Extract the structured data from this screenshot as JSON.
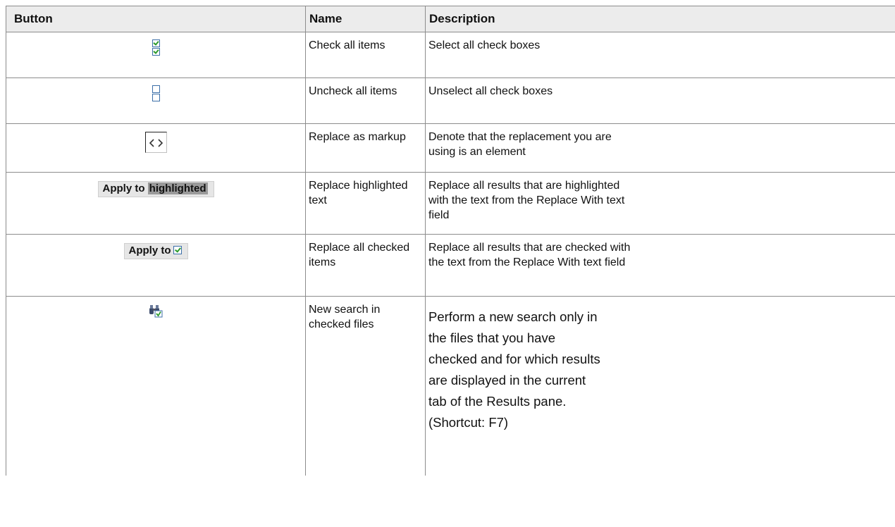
{
  "table": {
    "headers": [
      "Button",
      "Name",
      "Description"
    ],
    "rows": [
      {
        "icon": "check-all-icon",
        "name": "Check all items",
        "description": "Select all check boxes"
      },
      {
        "icon": "uncheck-all-icon",
        "name": "Uncheck all items",
        "description": "Unselect all check boxes"
      },
      {
        "icon": "markup-brackets-icon",
        "name": "Replace as markup",
        "description": "Denote that the replacement you are using is an element"
      },
      {
        "icon": "apply-highlighted-button",
        "button_text": "Apply to",
        "button_highlight": "highlighted",
        "name": "Replace highlighted text",
        "description": "Replace all results that are highlighted with the text from the Replace With text field"
      },
      {
        "icon": "apply-checked-button",
        "button_text": "Apply to",
        "name": "Replace all checked items",
        "description": "Replace all results that are checked with the text from the Replace With text field"
      },
      {
        "icon": "binoculars-check-icon",
        "name": "New search in checked files",
        "description": "Perform a new search only in the files that you have checked and for which results are displayed in the current tab of the Results pane. (Shortcut: F7)"
      }
    ]
  },
  "colors": {
    "header_bg": "#ececec",
    "border": "#8c8c8c",
    "checkbox_border": "#3c6fa8",
    "check": "#2d9b2d"
  }
}
